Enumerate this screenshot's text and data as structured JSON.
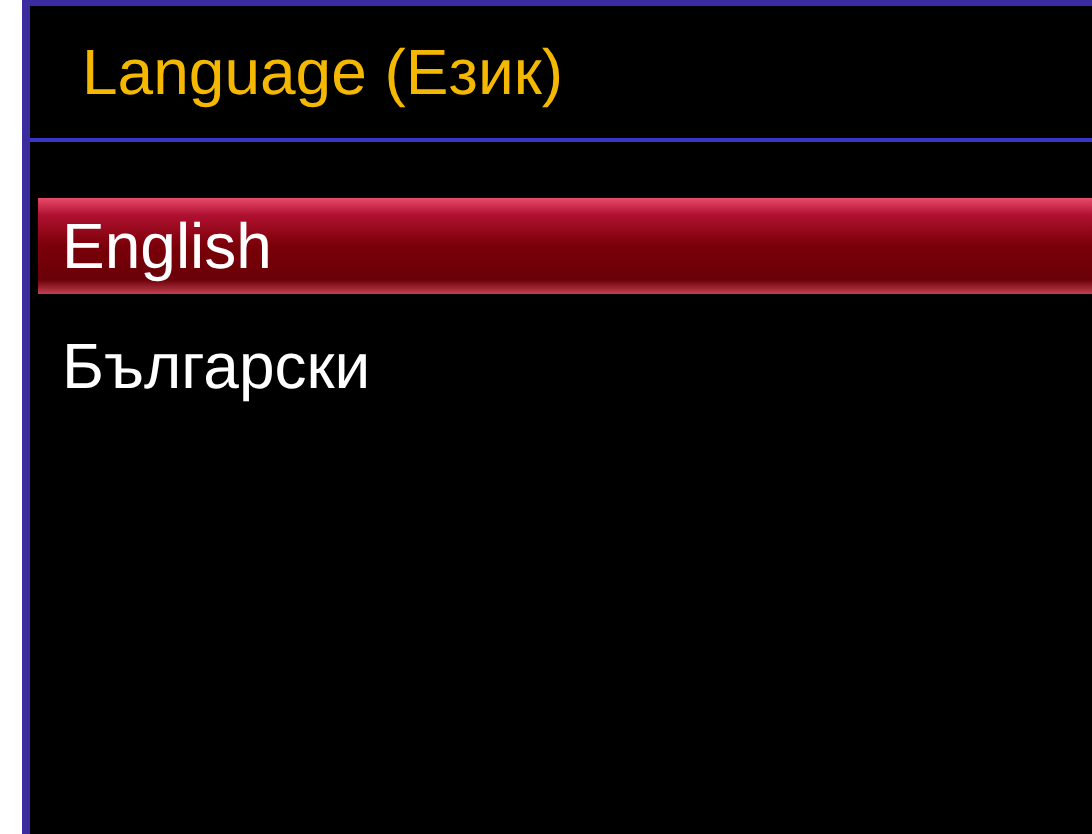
{
  "title": "Language (Език)",
  "languages": [
    {
      "label": "English",
      "selected": true
    },
    {
      "label": "Български",
      "selected": false
    }
  ]
}
